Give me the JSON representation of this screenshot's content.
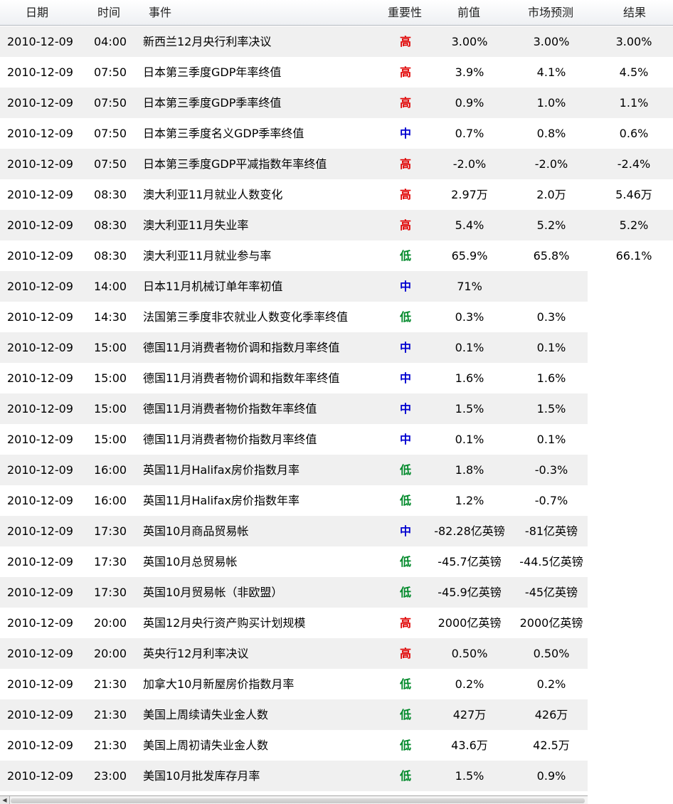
{
  "header": {
    "date": "日期",
    "time": "时间",
    "event": "事件",
    "importance": "重要性",
    "previous": "前值",
    "forecast": "市场预测",
    "result": "结果"
  },
  "colors": {
    "high": "#e00000",
    "medium": "#0000d0",
    "low": "#00892a"
  },
  "rows": [
    {
      "date": "2010-12-09",
      "time": "04:00",
      "event": "新西兰12月央行利率决议",
      "importance": "高",
      "level": "high",
      "previous": "3.00%",
      "forecast": "3.00%",
      "result": "3.00%"
    },
    {
      "date": "2010-12-09",
      "time": "07:50",
      "event": "日本第三季度GDP年率终值",
      "importance": "高",
      "level": "high",
      "previous": "3.9%",
      "forecast": "4.1%",
      "result": "4.5%"
    },
    {
      "date": "2010-12-09",
      "time": "07:50",
      "event": "日本第三季度GDP季率终值",
      "importance": "高",
      "level": "high",
      "previous": "0.9%",
      "forecast": "1.0%",
      "result": "1.1%"
    },
    {
      "date": "2010-12-09",
      "time": "07:50",
      "event": "日本第三季度名义GDP季率终值",
      "importance": "中",
      "level": "medium",
      "previous": "0.7%",
      "forecast": "0.8%",
      "result": "0.6%"
    },
    {
      "date": "2010-12-09",
      "time": "07:50",
      "event": "日本第三季度GDP平减指数年率终值",
      "importance": "高",
      "level": "high",
      "previous": "-2.0%",
      "forecast": "-2.0%",
      "result": "-2.4%"
    },
    {
      "date": "2010-12-09",
      "time": "08:30",
      "event": "澳大利亚11月就业人数变化",
      "importance": "高",
      "level": "high",
      "previous": "2.97万",
      "forecast": "2.0万",
      "result": "5.46万"
    },
    {
      "date": "2010-12-09",
      "time": "08:30",
      "event": "澳大利亚11月失业率",
      "importance": "高",
      "level": "high",
      "previous": "5.4%",
      "forecast": "5.2%",
      "result": "5.2%"
    },
    {
      "date": "2010-12-09",
      "time": "08:30",
      "event": "澳大利亚11月就业参与率",
      "importance": "低",
      "level": "low",
      "previous": "65.9%",
      "forecast": "65.8%",
      "result": "66.1%"
    },
    {
      "date": "2010-12-09",
      "time": "14:00",
      "event": "日本11月机械订单年率初值",
      "importance": "中",
      "level": "medium",
      "previous": "71%",
      "forecast": "",
      "result": ""
    },
    {
      "date": "2010-12-09",
      "time": "14:30",
      "event": "法国第三季度非农就业人数变化季率终值",
      "importance": "低",
      "level": "low",
      "previous": "0.3%",
      "forecast": "0.3%",
      "result": ""
    },
    {
      "date": "2010-12-09",
      "time": "15:00",
      "event": "德国11月消费者物价调和指数月率终值",
      "importance": "中",
      "level": "medium",
      "previous": "0.1%",
      "forecast": "0.1%",
      "result": ""
    },
    {
      "date": "2010-12-09",
      "time": "15:00",
      "event": "德国11月消费者物价调和指数年率终值",
      "importance": "中",
      "level": "medium",
      "previous": "1.6%",
      "forecast": "1.6%",
      "result": ""
    },
    {
      "date": "2010-12-09",
      "time": "15:00",
      "event": "德国11月消费者物价指数年率终值",
      "importance": "中",
      "level": "medium",
      "previous": "1.5%",
      "forecast": "1.5%",
      "result": ""
    },
    {
      "date": "2010-12-09",
      "time": "15:00",
      "event": "德国11月消费者物价指数月率终值",
      "importance": "中",
      "level": "medium",
      "previous": "0.1%",
      "forecast": "0.1%",
      "result": ""
    },
    {
      "date": "2010-12-09",
      "time": "16:00",
      "event": "英国11月Halifax房价指数月率",
      "importance": "低",
      "level": "low",
      "previous": "1.8%",
      "forecast": "-0.3%",
      "result": ""
    },
    {
      "date": "2010-12-09",
      "time": "16:00",
      "event": "英国11月Halifax房价指数年率",
      "importance": "低",
      "level": "low",
      "previous": "1.2%",
      "forecast": "-0.7%",
      "result": ""
    },
    {
      "date": "2010-12-09",
      "time": "17:30",
      "event": "英国10月商品贸易帐",
      "importance": "中",
      "level": "medium",
      "previous": "-82.28亿英镑",
      "forecast": "-81亿英镑",
      "result": ""
    },
    {
      "date": "2010-12-09",
      "time": "17:30",
      "event": "英国10月总贸易帐",
      "importance": "低",
      "level": "low",
      "previous": "-45.7亿英镑",
      "forecast": "-44.5亿英镑",
      "result": ""
    },
    {
      "date": "2010-12-09",
      "time": "17:30",
      "event": "英国10月贸易帐（非欧盟）",
      "importance": "低",
      "level": "low",
      "previous": "-45.9亿英镑",
      "forecast": "-45亿英镑",
      "result": ""
    },
    {
      "date": "2010-12-09",
      "time": "20:00",
      "event": "英国12月央行资产购买计划规模",
      "importance": "高",
      "level": "high",
      "previous": "2000亿英镑",
      "forecast": "2000亿英镑",
      "result": ""
    },
    {
      "date": "2010-12-09",
      "time": "20:00",
      "event": "英央行12月利率决议",
      "importance": "高",
      "level": "high",
      "previous": "0.50%",
      "forecast": "0.50%",
      "result": ""
    },
    {
      "date": "2010-12-09",
      "time": "21:30",
      "event": "加拿大10月新屋房价指数月率",
      "importance": "低",
      "level": "low",
      "previous": "0.2%",
      "forecast": "0.2%",
      "result": ""
    },
    {
      "date": "2010-12-09",
      "time": "21:30",
      "event": "美国上周续请失业金人数",
      "importance": "低",
      "level": "low",
      "previous": "427万",
      "forecast": "426万",
      "result": ""
    },
    {
      "date": "2010-12-09",
      "time": "21:30",
      "event": "美国上周初请失业金人数",
      "importance": "低",
      "level": "low",
      "previous": "43.6万",
      "forecast": "42.5万",
      "result": ""
    },
    {
      "date": "2010-12-09",
      "time": "23:00",
      "event": "美国10月批发库存月率",
      "importance": "低",
      "level": "low",
      "previous": "1.5%",
      "forecast": "0.9%",
      "result": ""
    }
  ]
}
